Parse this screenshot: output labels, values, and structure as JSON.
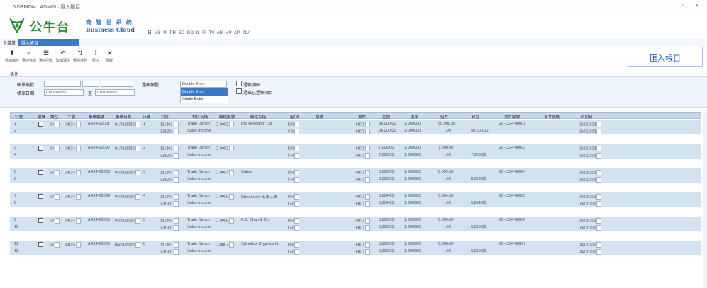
{
  "window": {
    "title": "5 DEMOM · ADMIN · 匯入帳目",
    "minimize": "–",
    "maximize": "▫",
    "close": "×"
  },
  "brand": {
    "cn_name": "公牛台",
    "cn_sub": "商 管 易 系 統",
    "en_name": "Business Cloud",
    "accent": "#2e8b3a"
  },
  "top_menu": "日 MS  PI  PR  SO  DO  IL  IR  TV  AR  MV  AP  INV",
  "tabs": {
    "prefix": "主菜單",
    "active": "匯入帳目"
  },
  "toolbar": [
    {
      "icon": "save-icon",
      "glyph": "⬇",
      "label": "數據儲存"
    },
    {
      "icon": "confirm-icon",
      "glyph": "✓",
      "label": "選擇數據"
    },
    {
      "icon": "select-icon",
      "glyph": "☰",
      "label": "選擇所有"
    },
    {
      "icon": "deselect-icon",
      "glyph": "↶",
      "label": "取消選擇"
    },
    {
      "icon": "reorder-icon",
      "glyph": "⇅",
      "label": "選擇排列"
    },
    {
      "icon": "import-icon",
      "glyph": "⇩",
      "label": "匯入"
    },
    {
      "icon": "close-icon",
      "glyph": "✕",
      "label": "關閉"
    }
  ],
  "page_banner": "匯入帳目",
  "section_label": "條件",
  "filters": {
    "voucher_label": "帳單編號",
    "date_label": "帳單日期",
    "date_from": "01/02/2020",
    "date_to_label": "至",
    "date_to": "01/02/2020",
    "entry_type_label": "過帳類型",
    "entry_type_value": "Double Entry",
    "entry_type_options": [
      "Double Entry",
      "Single Entry"
    ],
    "check1_label": "過帳明細",
    "check2_label": "過出已過帳項目"
  },
  "grid": {
    "columns": [
      "行號",
      "選擇",
      "類型",
      "字號",
      "帳單編號",
      "帳單日期",
      "行號",
      "科目",
      "科目名稱",
      "聯絡編號",
      "聯絡名稱",
      "借/貸",
      "描述",
      "貨幣",
      "金額",
      "匯率",
      "借方",
      "貸方",
      "文件編號",
      "參考號碼",
      "到期日"
    ],
    "groups": [
      {
        "no": "1",
        "line2": "2",
        "type": "JV",
        "prefix": "AR24",
        "voucher": "AR24-00001",
        "date": "01/01/2020",
        "seq": "1",
        "acc1": "111301",
        "acc2": "231301",
        "name1": "Trade Debtor",
        "name2": "Sales Income",
        "contact": "C-0002",
        "cname": "BIS Research Ltd.",
        "dc1": "DR",
        "dc2": "CR",
        "cur": "HKD",
        "amt1": "50,000.00",
        "amt2": "50,000.00",
        "rate": "1.000000",
        "debit1": "50,000.00",
        "debit2": ".00",
        "credit2": "50,000.00",
        "doc": "20-1224-00001",
        "due1": "02/01/202",
        "due2": "02/01/202"
      },
      {
        "no": "3",
        "line2": "4",
        "type": "JV",
        "prefix": "AR24",
        "voucher": "AR24-00002",
        "date": "01/01/2020",
        "seq": "2",
        "acc1": "111301",
        "acc2": "231301",
        "name1": "Trade Debtor",
        "name2": "Sales Income",
        "contact": "C-0003",
        "cname": "",
        "dc1": "DR",
        "dc2": "CR",
        "cur": "HKD",
        "amt1": "7,000.00",
        "amt2": "7,000.00",
        "rate": "1.000000",
        "debit1": "7,000.00",
        "debit2": ".00",
        "credit2": "7,000.00",
        "doc": "20-1224-00003",
        "due1": "02/01/202",
        "due2": "02/01/202"
      },
      {
        "no": "5",
        "line2": "6",
        "type": "JV",
        "prefix": "AR24",
        "voucher": "AR24-00003",
        "date": "03/01/2020",
        "seq": "3",
        "acc1": "111301",
        "acc2": "231301",
        "name1": "Trade Debtor",
        "name2": "Sales Income",
        "contact": "C-0004",
        "cname": "Cabaz",
        "dc1": "DR",
        "dc2": "CR",
        "cur": "HKD",
        "amt1": "8,009.00",
        "amt2": "8,009.00",
        "rate": "1.000000",
        "debit1": "8,009.00",
        "debit2": ".00",
        "credit2": "8,009.00",
        "doc": "20-1224-00004",
        "due1": "03/01/202",
        "due2": "03/01/202"
      },
      {
        "no": "7",
        "line2": "8",
        "type": "JV",
        "prefix": "AR24",
        "voucher": "AR24-00004",
        "date": "03/01/2020",
        "seq": "4",
        "acc1": "111301",
        "acc2": "231301",
        "name1": "Trade Debtor",
        "name2": "Sales Income",
        "contact": "C-0005",
        "cname": "StoreArtery 有限工業",
        "dc1": "DR",
        "dc2": "CR",
        "cur": "HKD",
        "amt1": "5,854.00",
        "amt2": "5,854.00",
        "rate": "1.000000",
        "debit1": "5,854.00",
        "debit2": ".00",
        "credit2": "5,854.00",
        "doc": "20-1224-00005",
        "due1": "03/01/202",
        "due2": "03/01/202"
      },
      {
        "no": "9",
        "line2": "10",
        "type": "JV",
        "prefix": "AR24",
        "voucher": "AR24-00005",
        "date": "03/01/2020",
        "seq": "5",
        "acc1": "111301",
        "acc2": "231301",
        "name1": "Trade Debtor",
        "name2": "Sales Income",
        "contact": "C-0006",
        "cname": "K.B. Chao & Co.",
        "dc1": "DR",
        "dc2": "CR",
        "cur": "HKD",
        "amt1": "5,800.00",
        "amt2": "5,800.00",
        "rate": "1.000000",
        "debit1": "5,800.00",
        "debit2": ".00",
        "credit2": "5,800.00",
        "doc": "20-1224-00006",
        "due1": "03/01/202",
        "due2": "03/01/202"
      },
      {
        "no": "11",
        "line2": "12",
        "type": "JV",
        "prefix": "AR24",
        "voucher": "AR24-00006",
        "date": "04/01/2020",
        "seq": "6",
        "acc1": "111301",
        "acc2": "231301",
        "name1": "Trade Debtor",
        "name2": "Sales Income",
        "contact": "C-0007",
        "cname": "Spinebox Organics Lt",
        "dc1": "DR",
        "dc2": "CR",
        "cur": "HKD",
        "amt1": "5,800.00",
        "amt2": "5,800.00",
        "rate": "1.000000",
        "debit1": "5,800.00",
        "debit2": ".00",
        "credit2": "5,800.00",
        "doc": "20-1224-00007",
        "due1": "04/01/202",
        "due2": "04/01/202"
      }
    ]
  }
}
